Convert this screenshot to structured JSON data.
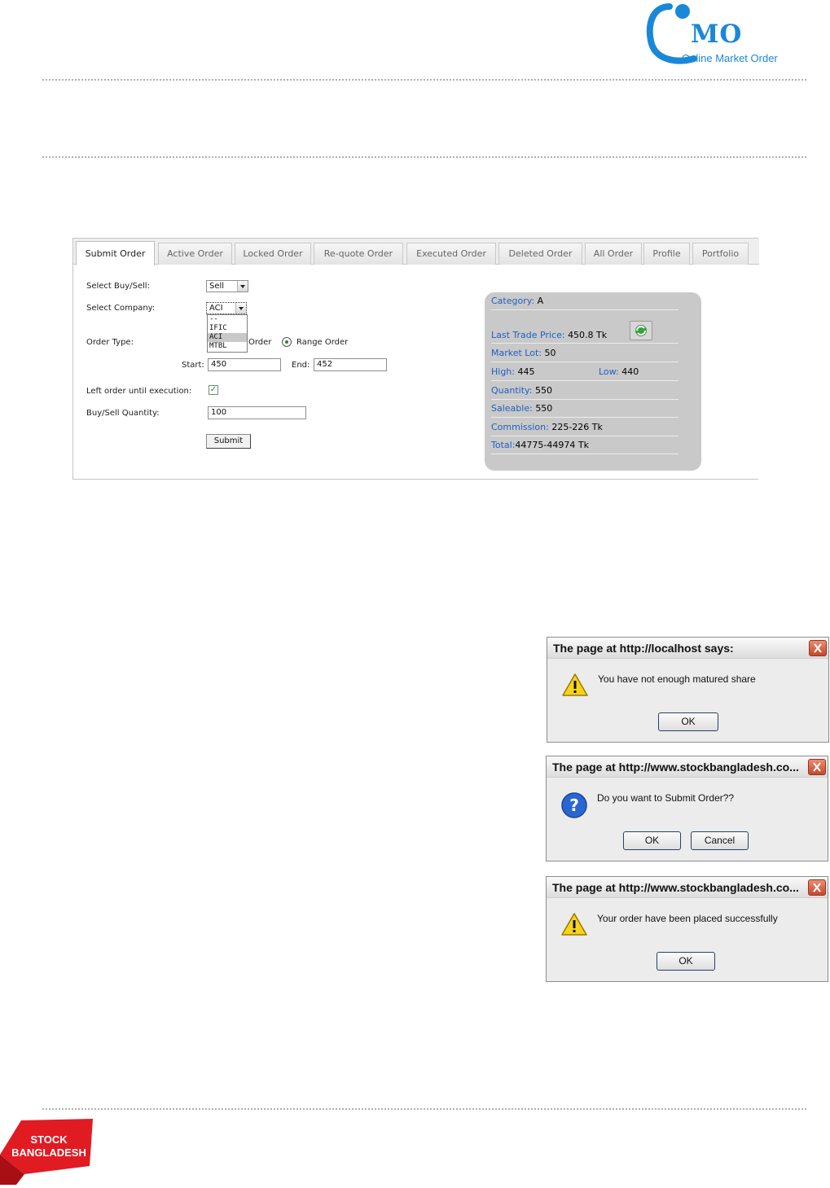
{
  "logo": {
    "word": "MO",
    "tagline": "Online Market Order"
  },
  "tabs": [
    {
      "label": "Submit Order",
      "active": true
    },
    {
      "label": "Active Order"
    },
    {
      "label": "Locked Order"
    },
    {
      "label": "Re-quote Order"
    },
    {
      "label": "Executed Order"
    },
    {
      "label": "Deleted Order"
    },
    {
      "label": "All Order"
    },
    {
      "label": "Profile"
    },
    {
      "label": "Portfolio"
    }
  ],
  "form": {
    "buy_sell_label": "Select Buy/Sell:",
    "buy_sell_value": "Sell",
    "company_label": "Select Company:",
    "company_value": "ACI",
    "company_options": [
      "--",
      "IFIC",
      "ACI",
      "MTBL"
    ],
    "order_type_label": "Order Type:",
    "order_type_market_partial": "Order",
    "order_type_range": "Range Order",
    "start_label": "Start:",
    "start_value": "450",
    "end_label": "End:",
    "end_value": "452",
    "left_order_label": "Left order until execution:",
    "left_order_checked": "✓",
    "quantity_label": "Buy/Sell Quantity:",
    "quantity_value": "100",
    "submit_label": "Submit"
  },
  "info": {
    "category_label": "Category:",
    "category_value": "A",
    "ltp_label": "Last Trade Price:",
    "ltp_value": "450.8 Tk",
    "lot_label": "Market Lot:",
    "lot_value": "50",
    "high_label": "High:",
    "high_value": "445",
    "low_label": "Low:",
    "low_value": "440",
    "qty_label": "Quantity:",
    "qty_value": "550",
    "saleable_label": "Saleable:",
    "saleable_value": "550",
    "commission_label": "Commission:",
    "commission_value": "225-226 Tk",
    "total_label": "Total:",
    "total_value": "44775-44974 Tk"
  },
  "dialogs": [
    {
      "title": "The page at http://localhost says:",
      "message": "You have not enough matured share",
      "ok": "OK",
      "icon": "warning-icon"
    },
    {
      "title": "The page at http://www.stockbangladesh.co...",
      "message": "Do you want to Submit Order??",
      "ok": "OK",
      "cancel": "Cancel",
      "icon": "question-icon"
    },
    {
      "title": "The page at http://www.stockbangladesh.co...",
      "message": "Your order have been placed successfully",
      "ok": "OK",
      "icon": "warning-icon"
    }
  ],
  "footer_brand": {
    "line1": "STOCK",
    "line2": "BANGLADESH"
  },
  "colors": {
    "accent_blue": "#1a88d8",
    "label_blue": "#1f5fc0",
    "brand_red": "#e11b22",
    "panel_gray": "#c9c9c9"
  }
}
